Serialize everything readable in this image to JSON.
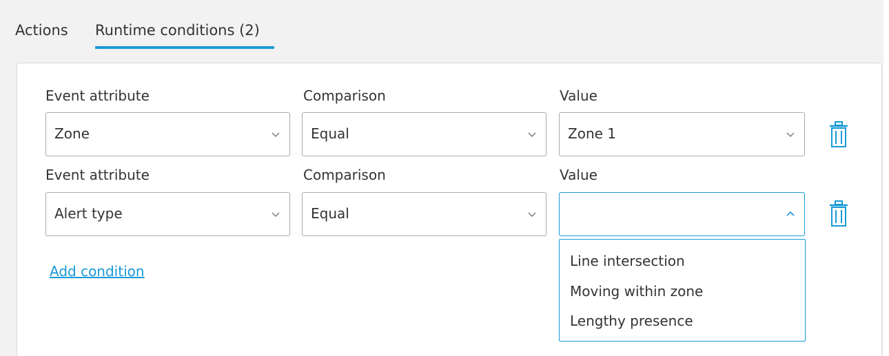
{
  "tabs": {
    "actions": "Actions",
    "runtime_conditions": "Runtime conditions (2)",
    "active": "runtime_conditions"
  },
  "conditions": [
    {
      "attribute_label": "Event attribute",
      "comparison_label": "Comparison",
      "value_label": "Value",
      "attribute": "Zone",
      "comparison": "Equal",
      "value": "Zone 1",
      "value_open": false
    },
    {
      "attribute_label": "Event attribute",
      "comparison_label": "Comparison",
      "value_label": "Value",
      "attribute": "Alert type",
      "comparison": "Equal",
      "value": "",
      "value_open": true
    }
  ],
  "add_condition_label": "Add condition",
  "value_dropdown": {
    "options": [
      "Line intersection",
      "Moving within zone",
      "Lengthy presence"
    ]
  },
  "icons": {
    "select_collapsed": "chevron-down-icon",
    "select_expanded": "chevron-up-icon",
    "delete": "trash-icon"
  },
  "colors": {
    "accent": "#1799d6",
    "background": "#f2f2f2",
    "panel": "#ffffff",
    "border": "#a9a9a9",
    "text": "#333333"
  }
}
